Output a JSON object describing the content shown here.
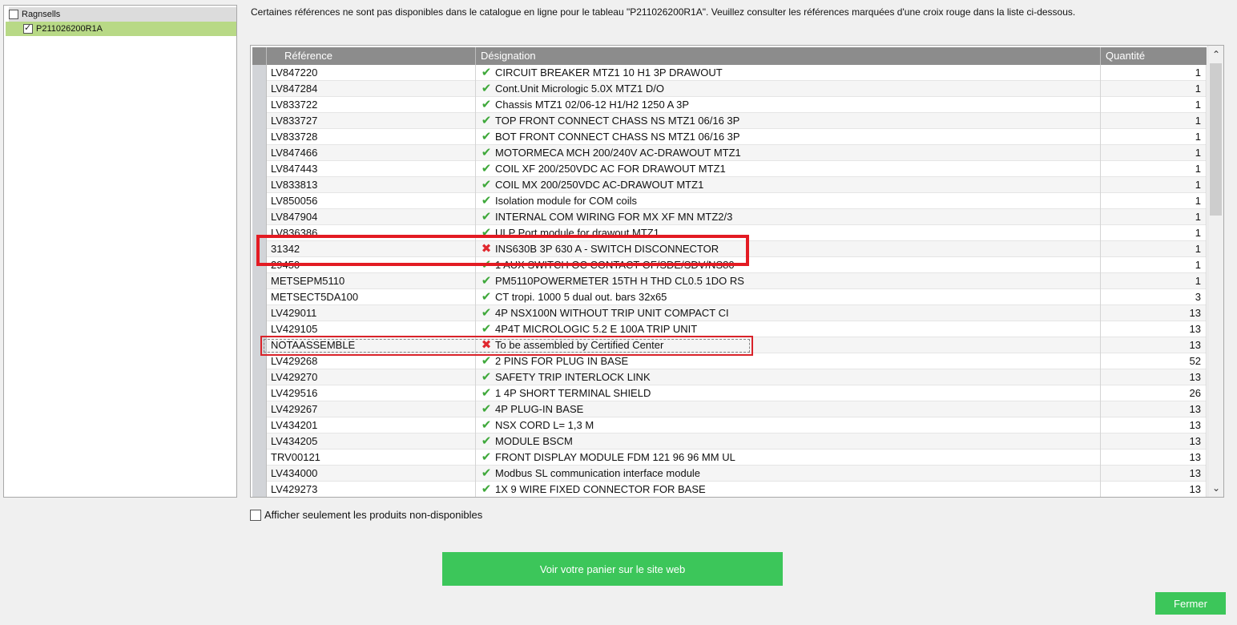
{
  "tree": {
    "root_label": "Ragnsells",
    "child_label": "P211026200R1A"
  },
  "message": "Certaines références ne sont pas disponibles dans le catalogue en ligne pour le tableau \"P211026200R1A\". Veuillez consulter les références marquées d'une croix rouge dans la liste ci-dessous.",
  "table": {
    "headers": [
      "Référence",
      "Désignation",
      "Quantité"
    ],
    "rows": [
      {
        "ref": "LV847220",
        "des": "CIRCUIT BREAKER MTZ1 10 H1 3P DRAWOUT",
        "qty": "1",
        "status": "ok"
      },
      {
        "ref": "LV847284",
        "des": "Cont.Unit Micrologic 5.0X MTZ1 D/O",
        "qty": "1",
        "status": "ok"
      },
      {
        "ref": "LV833722",
        "des": "Chassis MTZ1 02/06-12 H1/H2 1250 A 3P",
        "qty": "1",
        "status": "ok"
      },
      {
        "ref": "LV833727",
        "des": "TOP FRONT CONNECT CHASS NS MTZ1 06/16 3P",
        "qty": "1",
        "status": "ok"
      },
      {
        "ref": "LV833728",
        "des": "BOT FRONT CONNECT CHASS NS MTZ1 06/16 3P",
        "qty": "1",
        "status": "ok"
      },
      {
        "ref": "LV847466",
        "des": "MOTORMECA MCH 200/240V AC-DRAWOUT MTZ1",
        "qty": "1",
        "status": "ok"
      },
      {
        "ref": "LV847443",
        "des": "COIL XF 200/250VDC AC FOR DRAWOUT MTZ1",
        "qty": "1",
        "status": "ok"
      },
      {
        "ref": "LV833813",
        "des": "COIL MX 200/250VDC AC-DRAWOUT MTZ1",
        "qty": "1",
        "status": "ok"
      },
      {
        "ref": "LV850056",
        "des": "Isolation module for COM coils",
        "qty": "1",
        "status": "ok"
      },
      {
        "ref": "LV847904",
        "des": "INTERNAL COM WIRING FOR MX XF MN MTZ2/3",
        "qty": "1",
        "status": "ok"
      },
      {
        "ref": "LV836386",
        "des": "ULP Port module for drawout MTZ1",
        "qty": "1",
        "status": "ok"
      },
      {
        "ref": "31342",
        "des": "INS630B 3P 630 A - SWITCH DISCONNECTOR",
        "qty": "1",
        "status": "ko"
      },
      {
        "ref": "29450",
        "des": "1 AUX SWITCH OC CONTACT OF/SDE/SDV/NS80",
        "qty": "1",
        "status": "ok"
      },
      {
        "ref": "METSEPM5110",
        "des": "PM5110POWERMETER 15TH H THD CL0.5 1DO RS",
        "qty": "1",
        "status": "ok"
      },
      {
        "ref": "METSECT5DA100",
        "des": "CT tropi. 1000 5 dual out. bars 32x65",
        "qty": "3",
        "status": "ok"
      },
      {
        "ref": "LV429011",
        "des": "4P NSX100N WITHOUT TRIP UNIT COMPACT CI",
        "qty": "13",
        "status": "ok"
      },
      {
        "ref": "LV429105",
        "des": "4P4T MICROLOGIC 5.2 E 100A TRIP UNIT",
        "qty": "13",
        "status": "ok"
      },
      {
        "ref": "NOTAASSEMBLE",
        "des": "To be assembled by Certified Center",
        "qty": "13",
        "status": "ko"
      },
      {
        "ref": "LV429268",
        "des": "2 PINS FOR PLUG IN BASE",
        "qty": "52",
        "status": "ok"
      },
      {
        "ref": "LV429270",
        "des": "SAFETY TRIP INTERLOCK LINK",
        "qty": "13",
        "status": "ok"
      },
      {
        "ref": "LV429516",
        "des": "1 4P SHORT TERMINAL SHIELD",
        "qty": "26",
        "status": "ok"
      },
      {
        "ref": "LV429267",
        "des": "4P PLUG-IN BASE",
        "qty": "13",
        "status": "ok"
      },
      {
        "ref": "LV434201",
        "des": "NSX CORD L= 1,3 M",
        "qty": "13",
        "status": "ok"
      },
      {
        "ref": "LV434205",
        "des": "MODULE BSCM",
        "qty": "13",
        "status": "ok"
      },
      {
        "ref": "TRV00121",
        "des": "FRONT DISPLAY MODULE FDM 121 96 96 MM UL",
        "qty": "13",
        "status": "ok"
      },
      {
        "ref": "LV434000",
        "des": "Modbus SL communication interface module",
        "qty": "13",
        "status": "ok"
      },
      {
        "ref": "LV429273",
        "des": "1X 9 WIRE FIXED CONNECTOR FOR BASE",
        "qty": "13",
        "status": "ok"
      }
    ]
  },
  "icons": {
    "ok": "check-icon",
    "ko": "cross-icon",
    "ok_color": "#3ea83a",
    "ko_color": "#e0282e"
  },
  "filter_label": "Afficher seulement les produits non-disponibles",
  "buttons": {
    "web": "Voir votre panier sur le site web",
    "close": "Fermer"
  },
  "colors": {
    "accent": "#3cc65a",
    "header": "#8c8c8c",
    "selected": "#b8d986",
    "highlight": "#e31b23"
  }
}
